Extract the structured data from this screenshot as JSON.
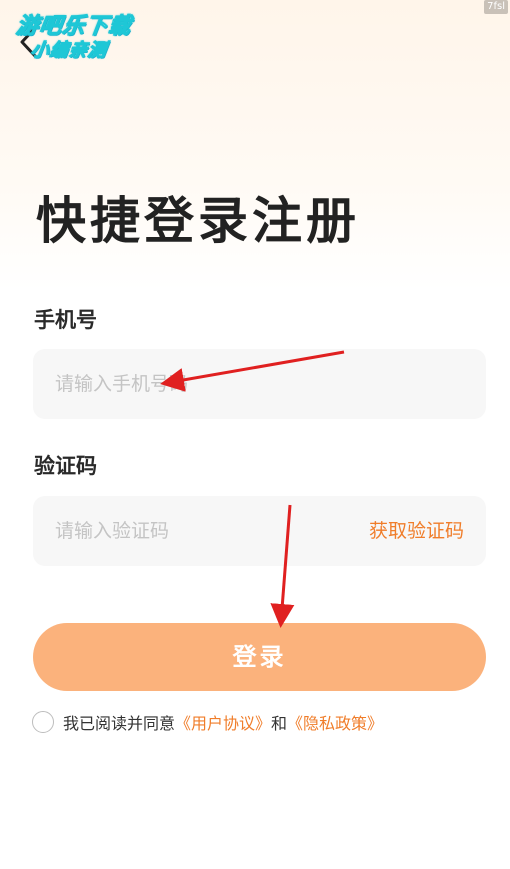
{
  "watermark": {
    "line1": "游吧乐下载",
    "line2": "小编亲测",
    "corner": "7fsl"
  },
  "header": {
    "title": "快捷登录注册"
  },
  "phone": {
    "label": "手机号",
    "placeholder": "请输入手机号码"
  },
  "code": {
    "label": "验证码",
    "placeholder": "请输入验证码",
    "get_code_label": "获取验证码"
  },
  "login": {
    "label": "登录"
  },
  "agreement": {
    "prefix": "我已阅读并同意",
    "user_agreement": "《用户协议》",
    "and": "和",
    "privacy_policy": "《隐私政策》"
  },
  "colors": {
    "accent": "#f07d2a",
    "button": "#fbb27c",
    "annotation_arrow": "#e02020"
  }
}
